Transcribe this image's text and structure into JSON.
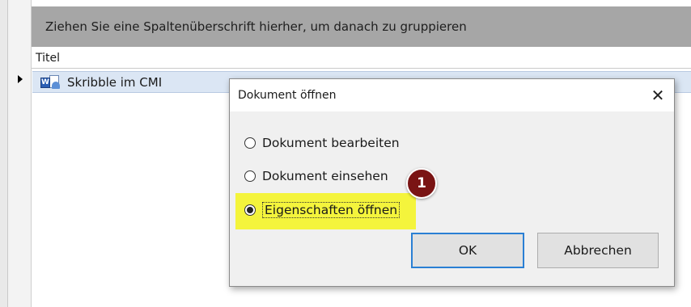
{
  "grid": {
    "group_panel_text": "Ziehen Sie eine Spaltenüberschrift hierher, um danach zu gruppieren",
    "column_header": "Titel",
    "rows": [
      {
        "icon": "word-document-icon",
        "title": "Skribble im CMI"
      }
    ]
  },
  "dialog": {
    "title": "Dokument öffnen",
    "close_glyph": "✕",
    "options": [
      {
        "label": "Dokument bearbeiten",
        "checked": false
      },
      {
        "label": "Dokument einsehen",
        "checked": false
      },
      {
        "label": "Eigenschaften öffnen",
        "checked": true
      }
    ],
    "ok_label": "OK",
    "cancel_label": "Abbrechen",
    "callout_number": "1"
  },
  "colors": {
    "highlight": "#f5f500",
    "callout": "#7a1414",
    "focus_border": "#2a7fd4",
    "row_selected": "#dbe6f4",
    "group_panel": "#a6a6a6"
  }
}
